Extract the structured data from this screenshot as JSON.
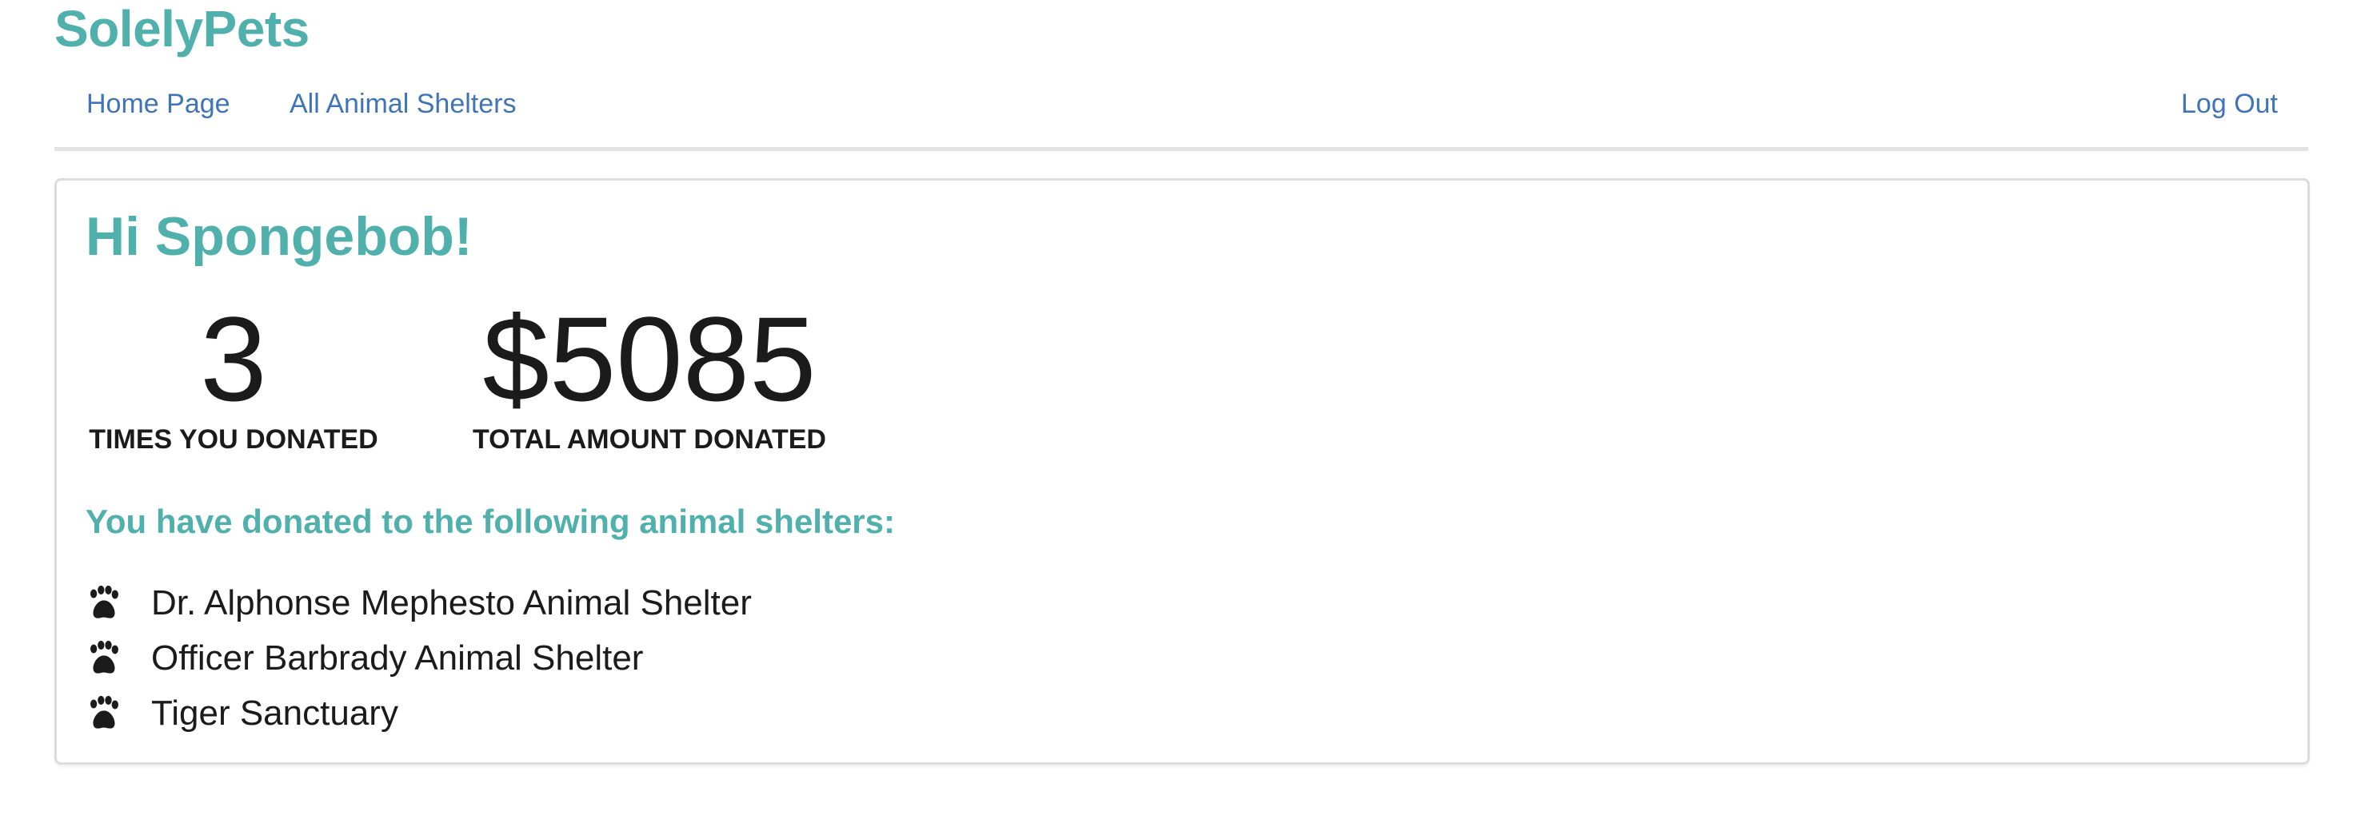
{
  "brand": {
    "name": "SolelyPets"
  },
  "nav": {
    "home": "Home Page",
    "shelters": "All Animal Shelters",
    "logout": "Log Out"
  },
  "profile": {
    "greeting": "Hi Spongebob!",
    "stats": {
      "times_donated": {
        "value": "3",
        "label": "TIMES YOU DONATED"
      },
      "total_donated": {
        "value": "$5085",
        "label": "TOTAL AMOUNT DONATED"
      }
    },
    "shelters_heading": "You have donated to the following animal shelters:",
    "shelters": [
      {
        "name": "Dr. Alphonse Mephesto Animal Shelter",
        "icon": "paw-icon"
      },
      {
        "name": "Officer Barbrady Animal Shelter",
        "icon": "paw-icon"
      },
      {
        "name": "Tiger Sanctuary",
        "icon": "paw-icon"
      }
    ]
  },
  "colors": {
    "brand": "#4fb0ac",
    "link": "#3f74b8",
    "text": "#1b1b1b",
    "divider": "#e2e2e2"
  }
}
